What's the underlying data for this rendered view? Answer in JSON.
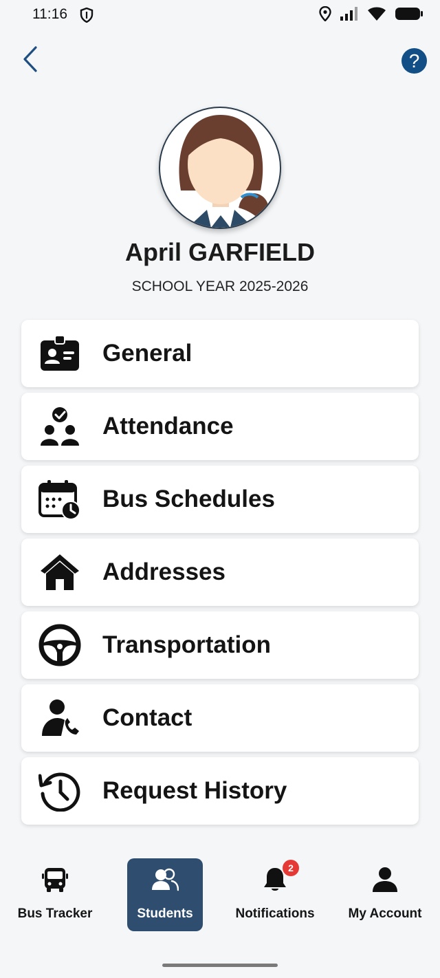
{
  "status_bar": {
    "time": "11:16"
  },
  "header": {
    "help_label": "?"
  },
  "profile": {
    "name": "April GARFIELD",
    "school_year": "SCHOOL YEAR 2025-2026"
  },
  "menu": [
    {
      "label": "General",
      "icon": "id-card-icon"
    },
    {
      "label": "Attendance",
      "icon": "attendance-group-icon"
    },
    {
      "label": "Bus Schedules",
      "icon": "calendar-clock-icon"
    },
    {
      "label": "Addresses",
      "icon": "house-icon"
    },
    {
      "label": "Transportation",
      "icon": "steering-wheel-icon"
    },
    {
      "label": "Contact",
      "icon": "person-phone-icon"
    },
    {
      "label": "Request History",
      "icon": "history-icon"
    }
  ],
  "bottom_nav": {
    "items": [
      {
        "label": "Bus Tracker",
        "icon": "bus-icon"
      },
      {
        "label": "Students",
        "icon": "students-icon",
        "active": true
      },
      {
        "label": "Notifications",
        "icon": "bell-icon",
        "badge": "2"
      },
      {
        "label": "My Account",
        "icon": "account-icon"
      }
    ]
  },
  "colors": {
    "accent": "#124f86",
    "active_nav": "#2f4e6f",
    "badge": "#e53935",
    "background": "#f4f6f8"
  }
}
